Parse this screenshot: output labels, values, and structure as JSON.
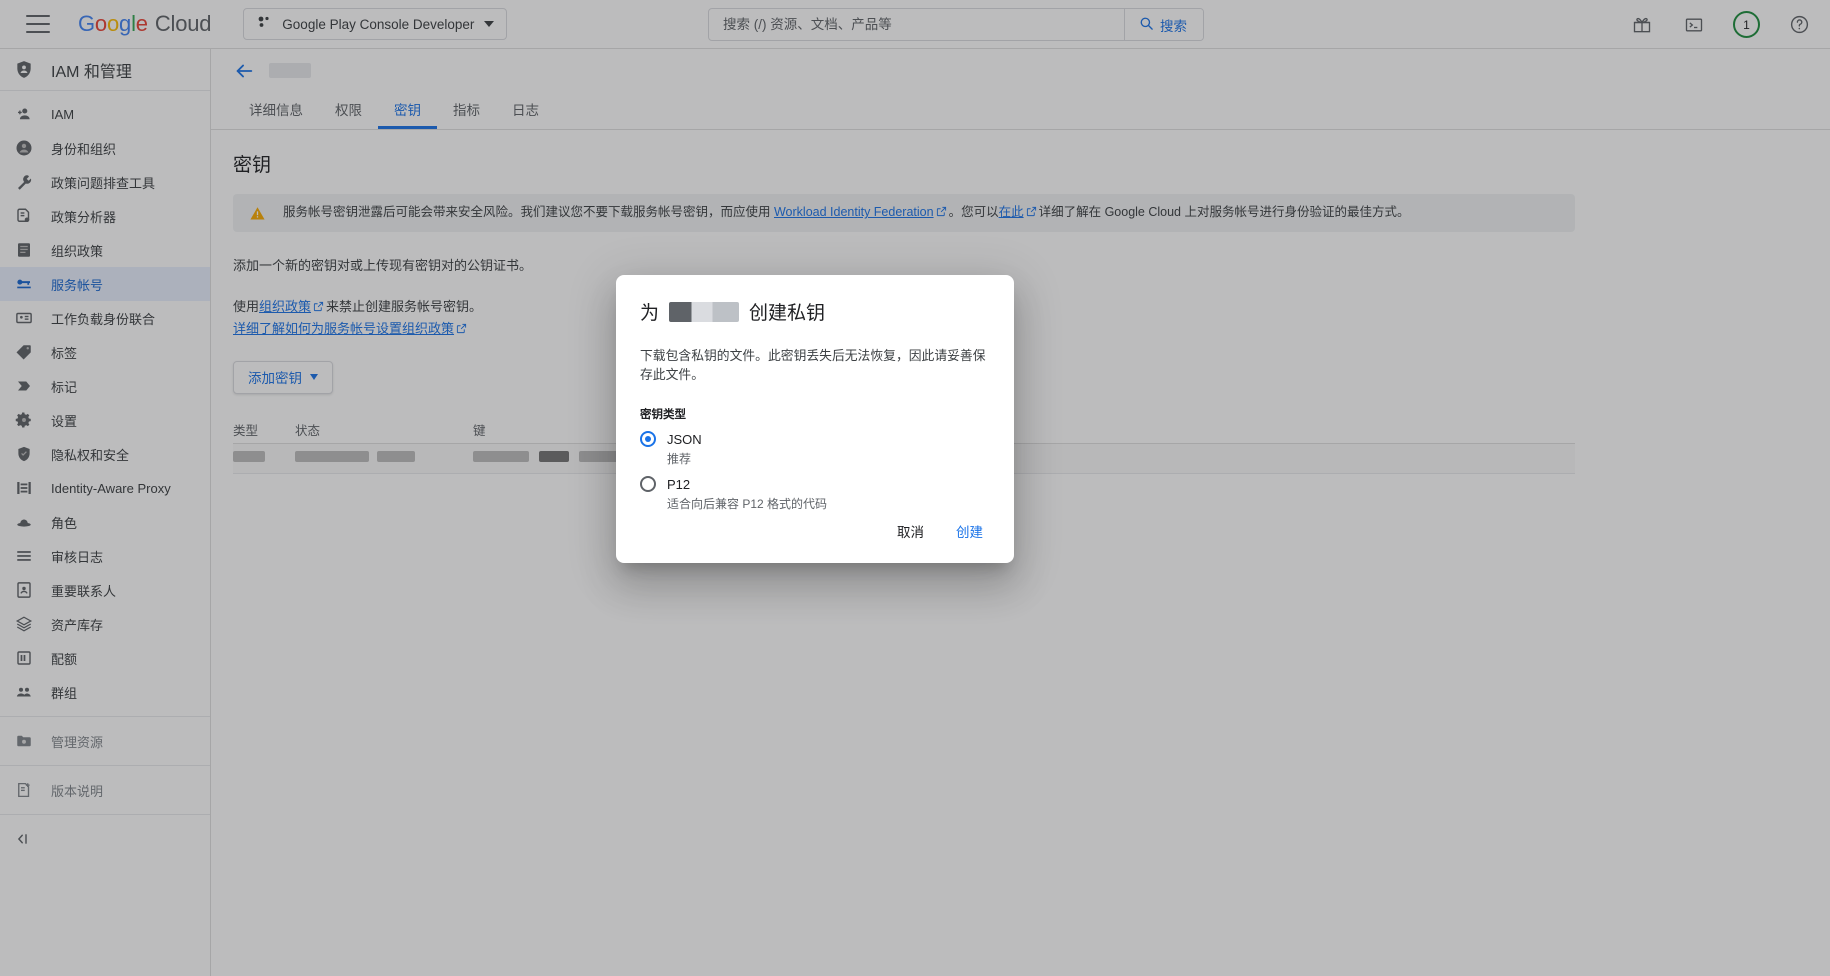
{
  "topbar": {
    "menu_icon": "hamburger-menu-icon",
    "logo_text": "Google",
    "logo_suffix": "Cloud",
    "project_name": "Google Play Console Developer",
    "search_placeholder": "搜索 (/) 资源、文档、产品等",
    "search_value": "",
    "search_button": "搜索",
    "gift_icon": "gift-icon",
    "terminal_icon": "cloud-shell-terminal-icon",
    "notification_count": "1",
    "help_icon": "help-circle-icon"
  },
  "sidebar": {
    "title": "IAM 和管理",
    "items": [
      {
        "label": "IAM",
        "icon": "person-add-icon"
      },
      {
        "label": "身份和组织",
        "icon": "account-circle-icon"
      },
      {
        "label": "政策问题排查工具",
        "icon": "wrench-icon"
      },
      {
        "label": "政策分析器",
        "icon": "document-search-icon"
      },
      {
        "label": "组织政策",
        "icon": "list-document-icon"
      },
      {
        "label": "服务帐号",
        "icon": "key-card-icon"
      },
      {
        "label": "工作负载身份联合",
        "icon": "id-card-icon"
      },
      {
        "label": "标签",
        "icon": "tag-icon"
      },
      {
        "label": "标记",
        "icon": "flag-tag-icon"
      },
      {
        "label": "设置",
        "icon": "gear-icon"
      },
      {
        "label": "隐私权和安全",
        "icon": "shield-icon"
      },
      {
        "label": "Identity-Aware Proxy",
        "icon": "proxy-icon"
      },
      {
        "label": "角色",
        "icon": "roles-icon"
      },
      {
        "label": "审核日志",
        "icon": "audit-log-icon"
      },
      {
        "label": "重要联系人",
        "icon": "contact-card-icon"
      },
      {
        "label": "资产库存",
        "icon": "asset-inventory-icon"
      },
      {
        "label": "配额",
        "icon": "quota-icon"
      },
      {
        "label": "群组",
        "icon": "groups-icon"
      }
    ],
    "footer_items": [
      {
        "label": "管理资源",
        "icon": "manage-resources-icon"
      },
      {
        "label": "版本说明",
        "icon": "release-notes-icon"
      }
    ],
    "active_item": "服务帐号",
    "collapse_icon": "collapse-panel-icon"
  },
  "main": {
    "back_icon": "back-arrow-icon",
    "tabs": [
      {
        "label": "详细信息",
        "active": false
      },
      {
        "label": "权限",
        "active": false
      },
      {
        "label": "密钥",
        "active": true
      },
      {
        "label": "指标",
        "active": false
      },
      {
        "label": "日志",
        "active": false
      }
    ],
    "heading": "密钥",
    "warning": {
      "icon": "warning-triangle-icon",
      "text_before": "服务帐号密钥泄露后可能会带来安全风险。我们建议您不要下载服务帐号密钥，而应使用 ",
      "link1": "Workload Identity Federation",
      "text_mid": "。您可以",
      "link2": "在此",
      "text_after": "详细了解在 Google Cloud 上对服务帐号进行身份验证的最佳方式。"
    },
    "intro": "添加一个新的密钥对或上传现有密钥对的公钥证书。",
    "policy_line_prefix": "使用",
    "policy_link": "组织政策",
    "policy_line_suffix": "来禁止创建服务帐号密钥。",
    "learn_more_link": "详细了解如何为服务帐号设置组织政策",
    "add_key_button": "添加密钥",
    "table": {
      "columns": [
        "类型",
        "状态",
        "键"
      ],
      "rows": [
        {
          "type": "",
          "status": "",
          "key": ""
        }
      ]
    }
  },
  "dialog": {
    "title_prefix": "为",
    "title_suffix": "创建私钥",
    "description": "下载包含私钥的文件。此密钥丢失后无法恢复，因此请妥善保存此文件。",
    "key_type_label": "密钥类型",
    "options": [
      {
        "label": "JSON",
        "sub": "推荐",
        "selected": true
      },
      {
        "label": "P12",
        "sub": "适合向后兼容 P12 格式的代码",
        "selected": false
      }
    ],
    "cancel_button": "取消",
    "create_button": "创建"
  },
  "colors": {
    "accent": "#1a73e8",
    "warning": "#f9ab00",
    "success": "#1e8e3e",
    "active_bg": "#e8f0fe",
    "text": "#3c4043"
  }
}
